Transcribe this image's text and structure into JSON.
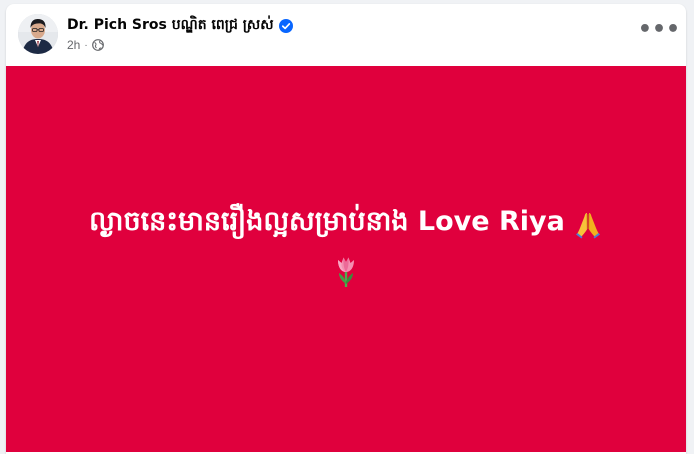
{
  "post": {
    "author_name": "Dr. Pich Sros បណ្ឌិត ពេជ្រ ស្រស់",
    "verified": true,
    "timestamp": "2h",
    "separator": "·",
    "audience_icon": "globe-icon",
    "more_icon": "more-options-icon",
    "more_label": "•••"
  },
  "status": {
    "text": "ល្ងាចនេះមានរឿងល្អសម្រាប់នាង Love Riya",
    "emoji_1": "folded-hands-emoji",
    "emoji_2": "tulip-emoji",
    "background_color": "#e0003d",
    "text_color": "#ffffff"
  },
  "colors": {
    "verified_badge": "#0866ff",
    "meta_text": "#65676b",
    "author_text": "#050505"
  }
}
